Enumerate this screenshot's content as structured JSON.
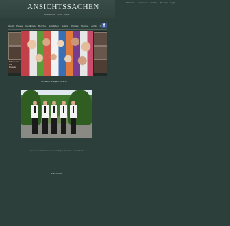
{
  "header": {
    "logo_text": "AnSichtsSachen",
    "tagline": "Gesellschaft · Politik · Kultur"
  },
  "top_links": [
    {
      "label": "Startseite"
    },
    {
      "label": "Impressum"
    },
    {
      "label": "Kontakt"
    },
    {
      "label": "Sitemap"
    },
    {
      "label": "Login"
    }
  ],
  "nav": [
    {
      "label": "Aktuell"
    },
    {
      "label": "Presse"
    },
    {
      "label": "Rundbriefe"
    },
    {
      "label": "Berichte"
    },
    {
      "label": "Schulleben"
    },
    {
      "label": "Galerie"
    },
    {
      "label": "Projekte"
    },
    {
      "label": "Termine"
    },
    {
      "label": "Archiv"
    },
    {
      "label": "Kontakt"
    }
  ],
  "social": {
    "facebook_glyph": "f"
  },
  "slideshow": {
    "thumb_caption": "Schulleben und Projekte"
  },
  "main": {
    "caption": "Im neuen Schuljahr 2012/13",
    "photo_caption": "Die neuen Mitarbeiter im Freiwilligen Sozialen Jahr 2012/13",
    "footer_text": "Zum Archiv"
  },
  "colors": {
    "background": "#2d3f3a",
    "facebook": "#3b5998"
  }
}
